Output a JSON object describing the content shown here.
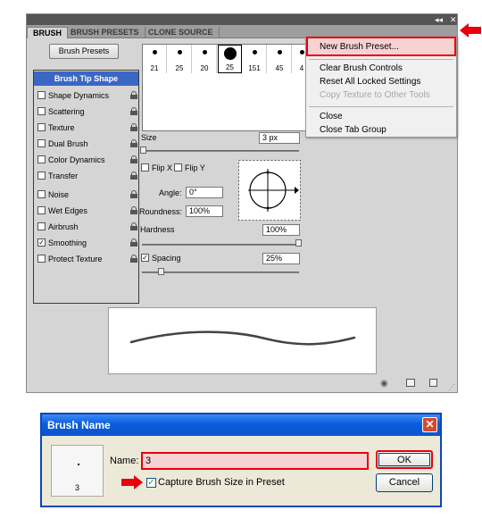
{
  "panel": {
    "tabs": [
      "BRUSH",
      "BRUSH PRESETS",
      "CLONE SOURCE"
    ],
    "topbar_icons": [
      "collapse-icon",
      "close-icon"
    ],
    "menu_button_icon": "panel-menu-icon",
    "brush_presets_button": "Brush Presets",
    "sidebar": {
      "header": "Brush Tip Shape",
      "items": [
        {
          "label": "Shape Dynamics",
          "checked": false
        },
        {
          "label": "Scattering",
          "checked": false
        },
        {
          "label": "Texture",
          "checked": false
        },
        {
          "label": "Dual Brush",
          "checked": false
        },
        {
          "label": "Color Dynamics",
          "checked": false
        },
        {
          "label": "Transfer",
          "checked": false
        },
        {
          "label": "Noise",
          "checked": false
        },
        {
          "label": "Wet Edges",
          "checked": false
        },
        {
          "label": "Airbrush",
          "checked": false
        },
        {
          "label": "Smoothing",
          "checked": true
        },
        {
          "label": "Protect Texture",
          "checked": false
        }
      ]
    },
    "brush_tips": [
      "21",
      "25",
      "20",
      "25",
      "151",
      "45",
      "4"
    ],
    "size": {
      "label": "Size",
      "value": "3 px"
    },
    "flip_x": "Flip X",
    "flip_y": "Flip Y",
    "angle": {
      "label": "Angle:",
      "value": "0°"
    },
    "roundness": {
      "label": "Roundness:",
      "value": "100%"
    },
    "hardness": {
      "label": "Hardness",
      "value": "100%"
    },
    "spacing": {
      "label": "Spacing",
      "value": "25%",
      "checked": true
    },
    "footer_icons": [
      "eye-icon",
      "grid-icon",
      "new-preset-icon"
    ]
  },
  "flyout_menu": {
    "items": [
      {
        "label": "New Brush Preset...",
        "disabled": false,
        "highlighted": true
      },
      {
        "label": "Clear Brush Controls",
        "disabled": false
      },
      {
        "label": "Reset All Locked Settings",
        "disabled": false
      },
      {
        "label": "Copy Texture to Other Tools",
        "disabled": true
      },
      {
        "label": "Close",
        "disabled": false
      },
      {
        "label": "Close Tab Group",
        "disabled": false
      }
    ]
  },
  "dialog": {
    "title": "Brush Name",
    "close_glyph": "✕",
    "preview_value": "3",
    "name_label": "Name:",
    "name_value": "3",
    "checkbox_label": "Capture Brush Size in Preset",
    "checkbox_checked": true,
    "ok_label": "OK",
    "cancel_label": "Cancel"
  },
  "colors": {
    "highlight_red": "#e8000d",
    "selection_blue": "#3b67c4",
    "xp_title_blue": "#0a5ddc"
  }
}
